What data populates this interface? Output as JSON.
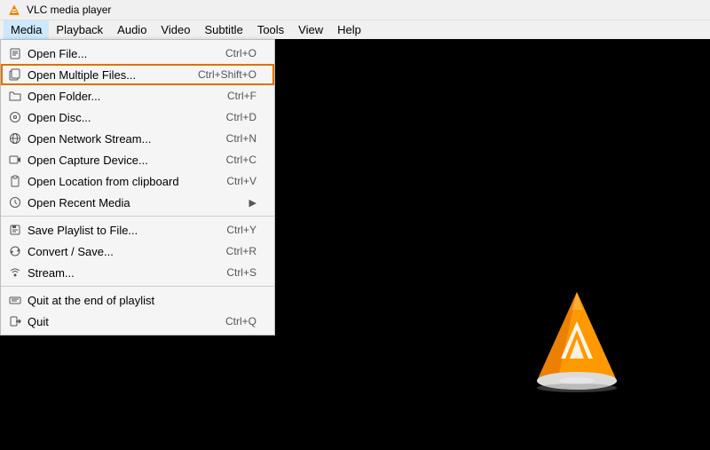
{
  "titleBar": {
    "title": "VLC media player"
  },
  "menuBar": {
    "items": [
      {
        "id": "media",
        "label": "Media",
        "active": true
      },
      {
        "id": "playback",
        "label": "Playback"
      },
      {
        "id": "audio",
        "label": "Audio"
      },
      {
        "id": "video",
        "label": "Video"
      },
      {
        "id": "subtitle",
        "label": "Subtitle"
      },
      {
        "id": "tools",
        "label": "Tools"
      },
      {
        "id": "view",
        "label": "View"
      },
      {
        "id": "help",
        "label": "Help"
      }
    ]
  },
  "mediaMenu": {
    "items": [
      {
        "id": "open-file",
        "label": "Open File...",
        "shortcut": "Ctrl+O",
        "icon": "file",
        "separator_after": false
      },
      {
        "id": "open-multiple",
        "label": "Open Multiple Files...",
        "shortcut": "Ctrl+Shift+O",
        "icon": "files",
        "highlighted": true,
        "separator_after": false
      },
      {
        "id": "open-folder",
        "label": "Open Folder...",
        "shortcut": "Ctrl+F",
        "icon": "folder",
        "separator_after": false
      },
      {
        "id": "open-disc",
        "label": "Open Disc...",
        "shortcut": "Ctrl+D",
        "icon": "disc",
        "separator_after": false
      },
      {
        "id": "open-network",
        "label": "Open Network Stream...",
        "shortcut": "Ctrl+N",
        "icon": "network",
        "separator_after": false
      },
      {
        "id": "open-capture",
        "label": "Open Capture Device...",
        "shortcut": "Ctrl+C",
        "icon": "capture",
        "separator_after": false
      },
      {
        "id": "open-clipboard",
        "label": "Open Location from clipboard",
        "shortcut": "Ctrl+V",
        "icon": "clipboard",
        "separator_after": false
      },
      {
        "id": "open-recent",
        "label": "Open Recent Media",
        "shortcut": "",
        "icon": "recent",
        "arrow": true,
        "separator_after": true
      },
      {
        "id": "save-playlist",
        "label": "Save Playlist to File...",
        "shortcut": "Ctrl+Y",
        "icon": "playlist",
        "separator_after": false
      },
      {
        "id": "convert",
        "label": "Convert / Save...",
        "shortcut": "Ctrl+R",
        "icon": "convert",
        "separator_after": false
      },
      {
        "id": "stream",
        "label": "Stream...",
        "shortcut": "Ctrl+S",
        "icon": "stream",
        "separator_after": true
      },
      {
        "id": "quit-playlist",
        "label": "Quit at the end of playlist",
        "shortcut": "",
        "icon": "",
        "separator_after": false
      },
      {
        "id": "quit",
        "label": "Quit",
        "shortcut": "Ctrl+Q",
        "icon": "exit",
        "separator_after": false
      }
    ]
  }
}
